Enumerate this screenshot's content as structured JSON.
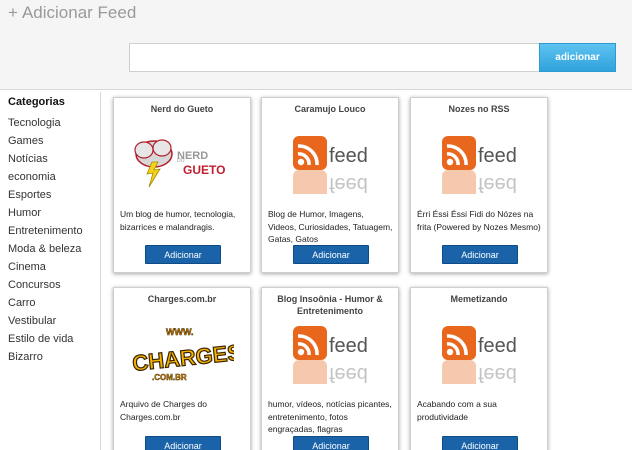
{
  "header": {
    "title": "Adicionar Feed",
    "search_placeholder": "",
    "search_value": "",
    "add_button_label": "adicionar"
  },
  "sidebar": {
    "heading": "Categorias",
    "items": [
      "Tecnologia",
      "Games",
      "Notícias",
      "economia",
      "Esportes",
      "Humor",
      "Entretenimento",
      "Moda & beleza",
      "Cinema",
      "Concursos",
      "Carro",
      "Vestibular",
      "Estilo de vida",
      "Bizarro"
    ]
  },
  "feeds": [
    {
      "title": "Nerd do Gueto",
      "logo": "nerd-do-gueto-logo",
      "logo_text_top": "NERD",
      "logo_text_bottom": "GUETO",
      "description": "Um blog de humor, tecnologia, bizarrices e malandragis.",
      "button_label": "Adicionar"
    },
    {
      "title": "Caramujo Louco",
      "logo": "rss-feed-icon",
      "logo_text": "feed",
      "description": "Blog de Humor, Imagens, Videos, Curiosidades, Tatuagem, Gatas, Gatos",
      "button_label": "Adicionar"
    },
    {
      "title": "Nozes no RSS",
      "logo": "rss-feed-icon",
      "logo_text": "feed",
      "description": "Érri Éssi Éssi Fidi do Nózes na frita (Powered by Nozes Mesmo)",
      "button_label": "Adicionar"
    },
    {
      "title": "Charges.com.br",
      "logo": "charges-logo",
      "logo_text_top": "WWW.",
      "logo_text": "CHARGES",
      "logo_text_bottom": ".COM.BR",
      "description": "Arquivo de Charges do Charges.com.br",
      "button_label": "Adicionar"
    },
    {
      "title": "Blog Insoônia - Humor & Entretenimento",
      "logo": "rss-feed-icon",
      "logo_text": "feed",
      "description": "humor, vídeos, notícias picantes, entretenimento, fotos engraçadas, flagras",
      "button_label": "Adicionar"
    },
    {
      "title": "Memetizando",
      "logo": "rss-feed-icon",
      "logo_text": "feed",
      "description": "Acabando com a sua produtividade",
      "button_label": "Adicionar"
    }
  ],
  "colors": {
    "accent": "#2fa2dd",
    "button": "#1a63a8",
    "rss_orange": "#e8671c"
  }
}
